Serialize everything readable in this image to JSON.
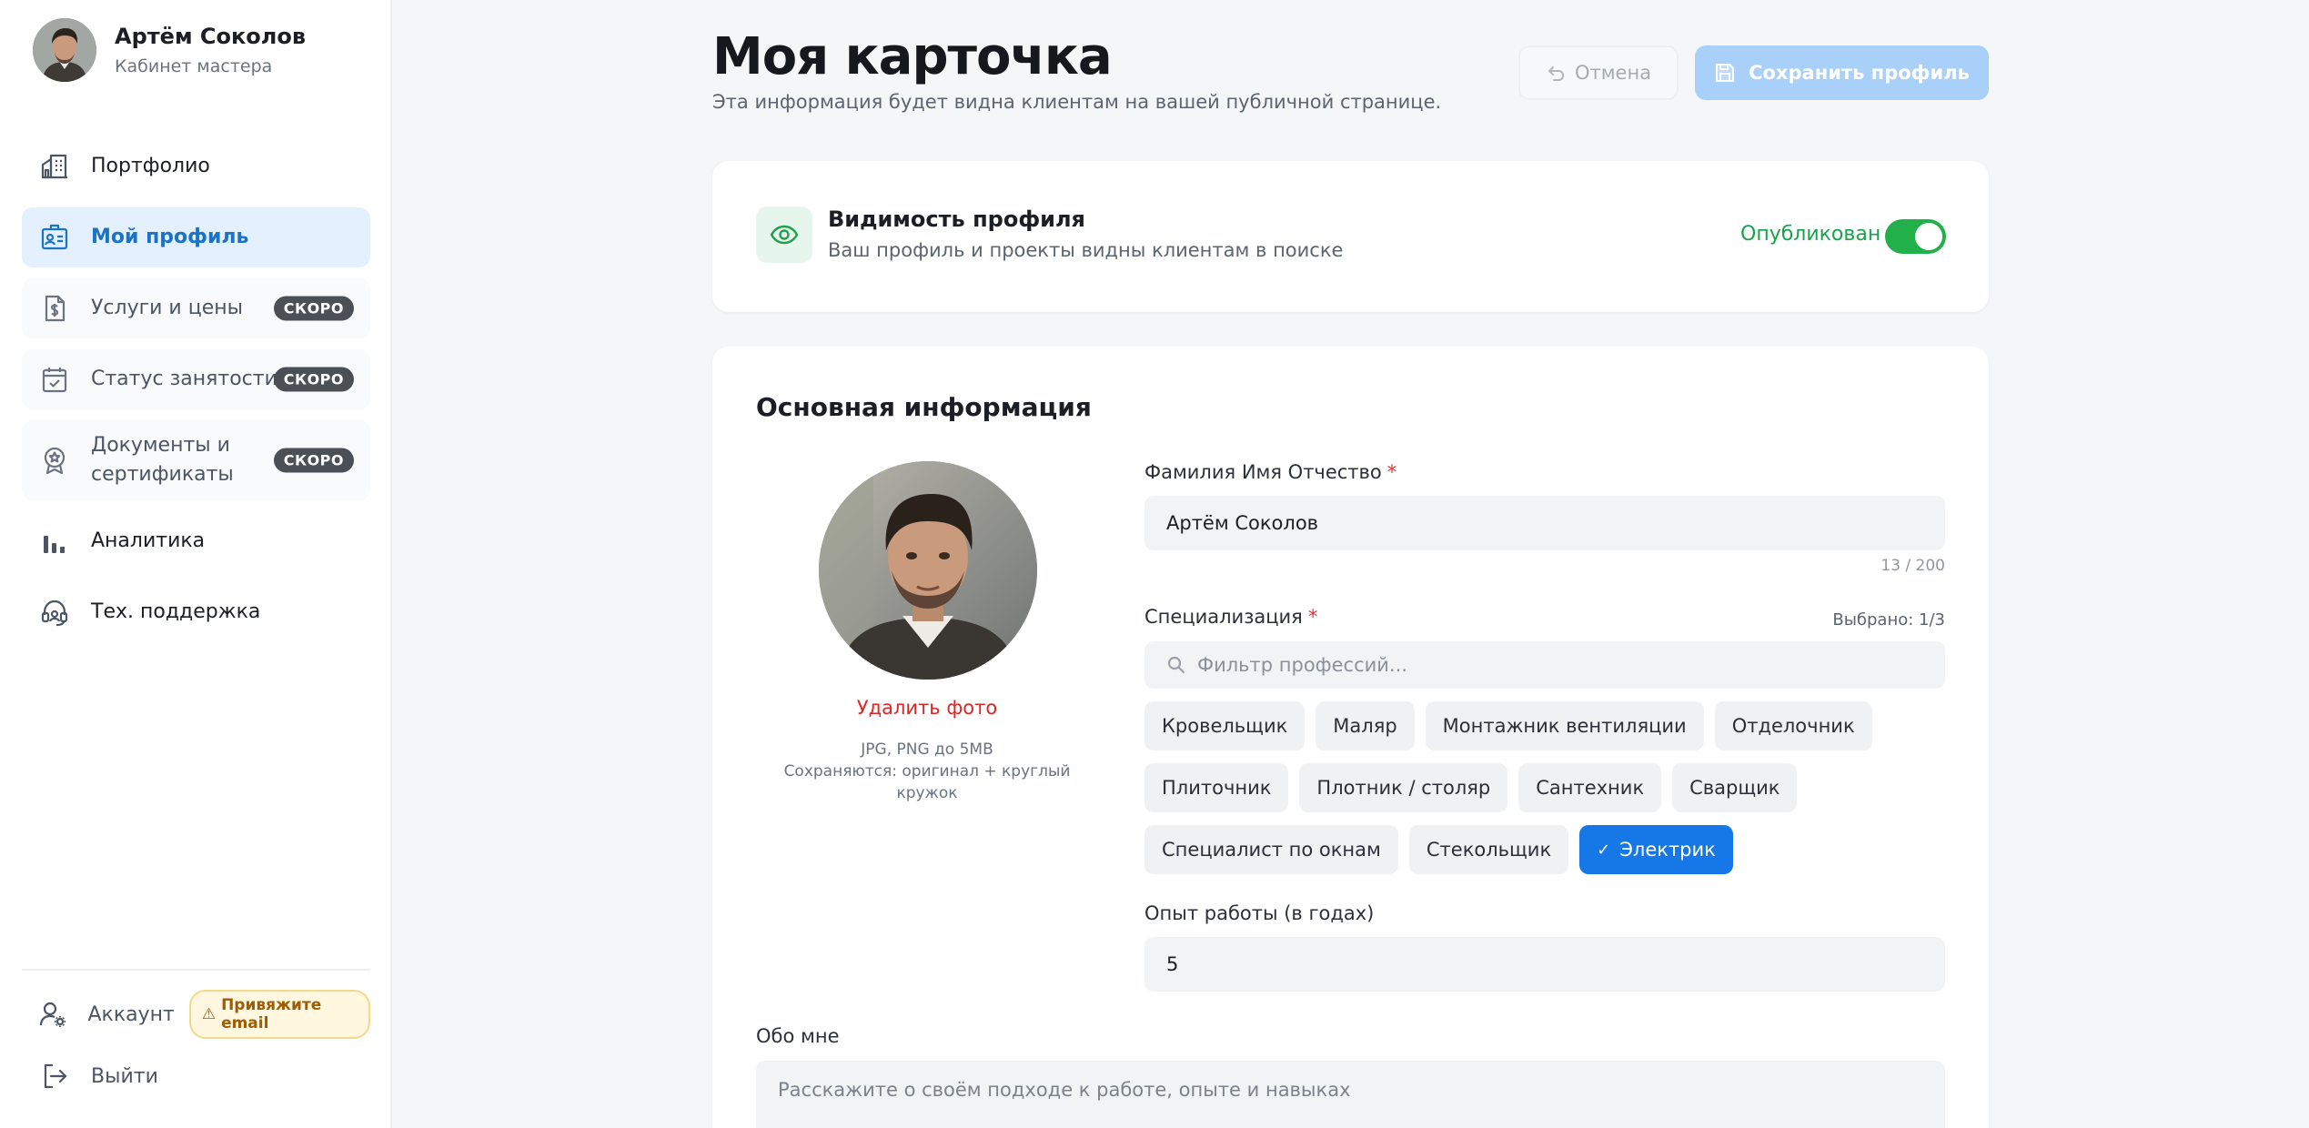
{
  "sidebar": {
    "user": {
      "name": "Артём Соколов",
      "role": "Кабинет мастера"
    },
    "items": [
      {
        "label": "Портфолио",
        "icon": "building-icon",
        "state": "normal"
      },
      {
        "label": "Мой профиль",
        "icon": "id-card-icon",
        "state": "active"
      },
      {
        "label": "Услуги и цены",
        "icon": "price-document-icon",
        "state": "soon",
        "badge": "СКОРО"
      },
      {
        "label": "Статус занятости",
        "icon": "calendar-check-icon",
        "state": "soon",
        "badge": "СКОРО"
      },
      {
        "label_line1": "Документы и",
        "label_line2": "сертификаты",
        "icon": "award-icon",
        "state": "soon",
        "badge": "СКОРО"
      },
      {
        "label": "Аналитика",
        "icon": "bar-chart-icon",
        "state": "normal"
      },
      {
        "label": "Тех. поддержка",
        "icon": "headset-icon",
        "state": "normal"
      }
    ],
    "bottom": {
      "account_label": "Аккаунт",
      "email_badge": "Привяжите email",
      "logout_label": "Выйти"
    }
  },
  "header": {
    "title": "Моя карточка",
    "subtitle": "Эта информация будет видна клиентам на вашей публичной странице.",
    "cancel_label": "Отмена",
    "save_label": "Сохранить профиль"
  },
  "visibility": {
    "title": "Видимость профиля",
    "subtitle": "Ваш профиль и проекты видны клиентам в поиске",
    "status_label": "Опубликован",
    "published": true
  },
  "basic_info": {
    "title": "Основная информация",
    "photo": {
      "delete_label": "Удалить фото",
      "hint_line1": "JPG, PNG до 5MB",
      "hint_line2": "Сохраняются: оригинал + круглый кружок"
    },
    "full_name": {
      "label": "Фамилия Имя Отчество",
      "required_mark": "*",
      "value": "Артём Соколов",
      "counter": "13 / 200"
    },
    "specialization": {
      "label": "Специализация",
      "required_mark": "*",
      "selected_info": "Выбрано: 1/3",
      "filter_placeholder": "Фильтр профессий...",
      "rows": [
        [
          "Кровельщик",
          "Маляр",
          "Монтажник вентиляции",
          "Отделочник"
        ],
        [
          "Плиточник",
          "Плотник / столяр",
          "Сантехник",
          "Сварщик"
        ],
        [
          "Специалист по окнам",
          "Стекольщик",
          "Электрик"
        ]
      ],
      "selected": [
        "Электрик"
      ]
    },
    "experience": {
      "label": "Опыт работы (в годах)",
      "value": "5"
    },
    "about": {
      "label": "Обо мне",
      "placeholder": "Расскажите о своём подходе к работе, опыте и навыках"
    }
  },
  "colors": {
    "accent": "#1677e6",
    "active_nav_bg": "#e4f0fd",
    "save_disabled": "#a9d0f8",
    "published_green": "#22b04b",
    "danger": "#dc2626"
  }
}
